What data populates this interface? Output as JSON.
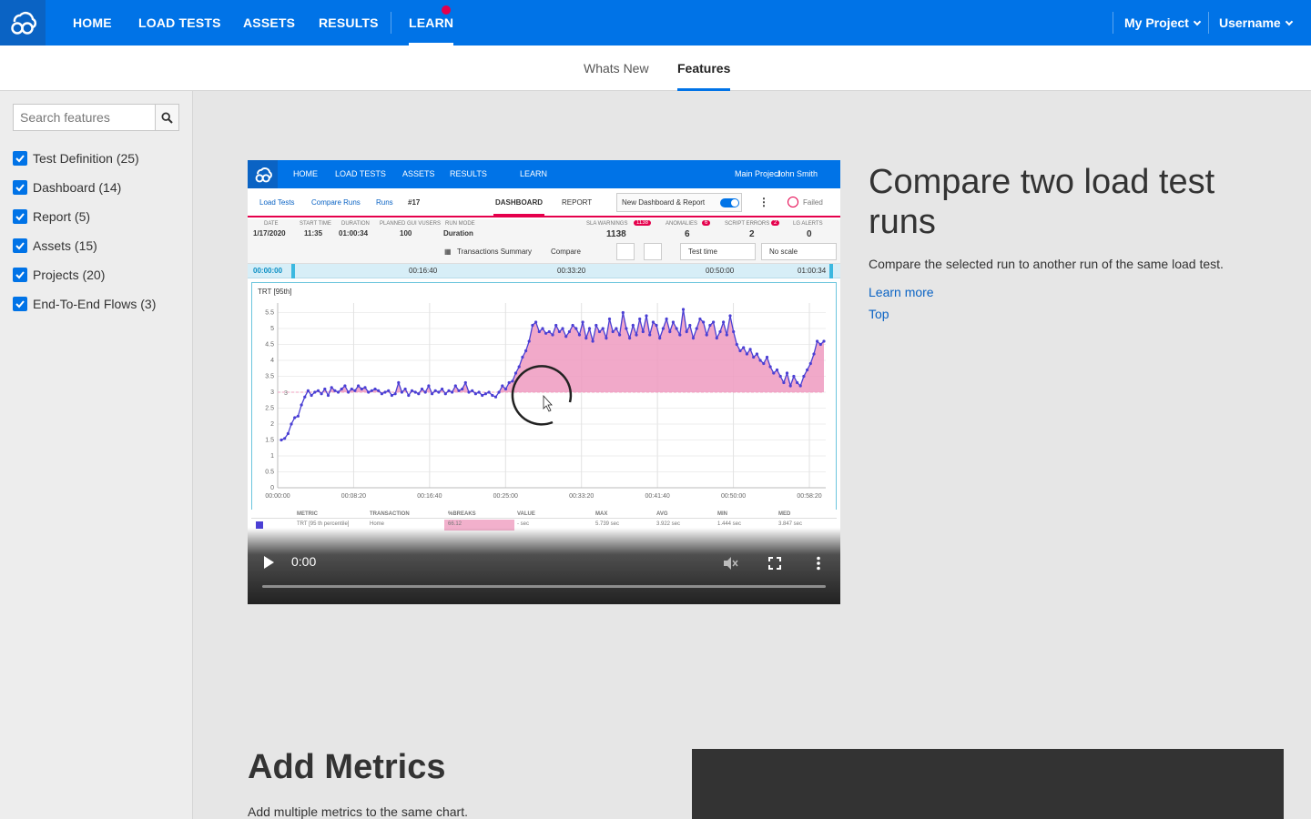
{
  "nav": {
    "items": [
      {
        "label": "HOME"
      },
      {
        "label": "LOAD TESTS"
      },
      {
        "label": "ASSETS"
      },
      {
        "label": "RESULTS"
      },
      {
        "label": "LEARN"
      }
    ],
    "project": "My Project",
    "user": "Username"
  },
  "subnav": {
    "tabs": [
      {
        "label": "Whats New"
      },
      {
        "label": "Features"
      }
    ]
  },
  "sidebar": {
    "search_placeholder": "Search features",
    "filters": [
      {
        "label": "Test Definition (25)"
      },
      {
        "label": "Dashboard (14)"
      },
      {
        "label": "Report (5)"
      },
      {
        "label": "Assets (15)"
      },
      {
        "label": "Projects (20)"
      },
      {
        "label": "End-To-End Flows (3)"
      }
    ]
  },
  "feature": {
    "title": "Compare two load test runs",
    "description": "Compare the selected run to another run of the same load test.",
    "learn_more": "Learn more",
    "top": "Top"
  },
  "section2": {
    "title": "Add Metrics",
    "description": "Add multiple metrics to the same chart."
  },
  "video": {
    "time": "0:00",
    "app": {
      "nav": [
        "HOME",
        "LOAD TESTS",
        "ASSETS",
        "RESULTS",
        "LEARN"
      ],
      "project": "Main Project",
      "user": "John Smith",
      "breadcrumb": [
        "Load Tests",
        "Compare Runs",
        "Runs",
        "#17"
      ],
      "tabs": [
        "DASHBOARD",
        "REPORT"
      ],
      "toggle_label": "New Dashboard & Report",
      "status": "Failed",
      "stats": [
        {
          "label": "DATE",
          "value": "1/17/2020"
        },
        {
          "label": "START TIME",
          "value": "11:35"
        },
        {
          "label": "DURATION",
          "value": "01:00:34"
        },
        {
          "label": "PLANNED GUI VUSERS",
          "value": "100"
        },
        {
          "label": "RUN MODE",
          "value": "Duration"
        }
      ],
      "kpis": [
        {
          "label": "SLA WARNINGS",
          "badge": "1138",
          "value": "1138"
        },
        {
          "label": "ANOMALIES",
          "badge": "6",
          "value": "6"
        },
        {
          "label": "SCRIPT ERRORS",
          "badge": "2",
          "value": "2"
        },
        {
          "label": "LG ALERTS",
          "value": "0"
        }
      ],
      "toolbar": {
        "summary": "Transactions Summary",
        "compare": "Compare",
        "time_select": "Test time",
        "scale_select": "No scale"
      },
      "timeline": [
        "00:00:00",
        "00:16:40",
        "00:33:20",
        "00:50:00",
        "01:00:34"
      ],
      "chart_title": "TRT [95th]",
      "table": {
        "headers": [
          "METRIC",
          "TRANSACTION",
          "%BREAKS",
          "VALUE",
          "MAX",
          "AVG",
          "MIN",
          "MED"
        ],
        "row": [
          "TRT [95 th percentile]",
          "Home",
          "66.12",
          "- sec",
          "5.739 sec",
          "3.922 sec",
          "1.444 sec",
          "3.847 sec"
        ]
      }
    }
  },
  "chart_data": {
    "type": "line",
    "title": "TRT [95th]",
    "xlabel": "",
    "ylabel": "",
    "x_ticks": [
      "00:00:00",
      "00:08:20",
      "00:16:40",
      "00:25:00",
      "00:33:20",
      "00:41:40",
      "00:50:00",
      "00:58:20"
    ],
    "y_ticks": [
      0,
      0.5,
      1,
      1.5,
      2,
      2.5,
      3,
      3.5,
      4,
      4.5,
      5,
      5.5
    ],
    "ylim": [
      0,
      5.8
    ],
    "threshold": 3,
    "threshold_label": "3",
    "series": [
      {
        "values": [
          1.5,
          1.55,
          1.7,
          2.0,
          2.2,
          2.25,
          2.6,
          2.85,
          3.05,
          2.9,
          3.0,
          3.05,
          2.95,
          3.1,
          2.9,
          3.15,
          3.05,
          3.0,
          3.1,
          3.2,
          3.0,
          3.1,
          3.05,
          3.2,
          3.1,
          3.15,
          3.0,
          3.05,
          3.1,
          3.05,
          2.95,
          3.0,
          3.05,
          2.9,
          2.95,
          3.3,
          3.0,
          3.1,
          2.9,
          3.05,
          3.0,
          2.95,
          3.1,
          3.0,
          3.2,
          2.95,
          3.05,
          3.0,
          3.1,
          2.95,
          3.05,
          3.0,
          3.2,
          3.05,
          3.1,
          3.3,
          3.0,
          3.05,
          2.95,
          3.0,
          2.9,
          2.95,
          3.0,
          2.9,
          2.85,
          3.0,
          3.2,
          3.1,
          3.3,
          3.35,
          3.6,
          3.8,
          4.1,
          4.3,
          4.6,
          5.1,
          5.2,
          4.9,
          5.0,
          4.85,
          4.9,
          4.8,
          5.1,
          4.9,
          5.0,
          4.75,
          4.9,
          5.1,
          5.0,
          4.8,
          5.2,
          4.7,
          5.0,
          4.6,
          5.1,
          4.9,
          5.0,
          4.7,
          5.3,
          4.9,
          5.0,
          4.8,
          5.5,
          5.0,
          4.7,
          5.1,
          4.8,
          5.3,
          4.9,
          5.4,
          4.8,
          5.2,
          5.1,
          4.7,
          5.0,
          5.3,
          4.9,
          5.2,
          5.0,
          4.8,
          5.6,
          4.9,
          5.1,
          4.7,
          5.0,
          5.3,
          5.2,
          4.8,
          5.1,
          5.2,
          4.7,
          4.9,
          5.2,
          4.8,
          5.4,
          4.9,
          4.5,
          4.3,
          4.4,
          4.2,
          4.35,
          4.1,
          4.2,
          4.0,
          3.9,
          4.1,
          3.8,
          3.6,
          3.7,
          3.5,
          3.3,
          3.6,
          3.2,
          3.5,
          3.3,
          3.2,
          3.5,
          3.7,
          3.9,
          4.2,
          4.6,
          4.5,
          4.6
        ]
      }
    ]
  }
}
